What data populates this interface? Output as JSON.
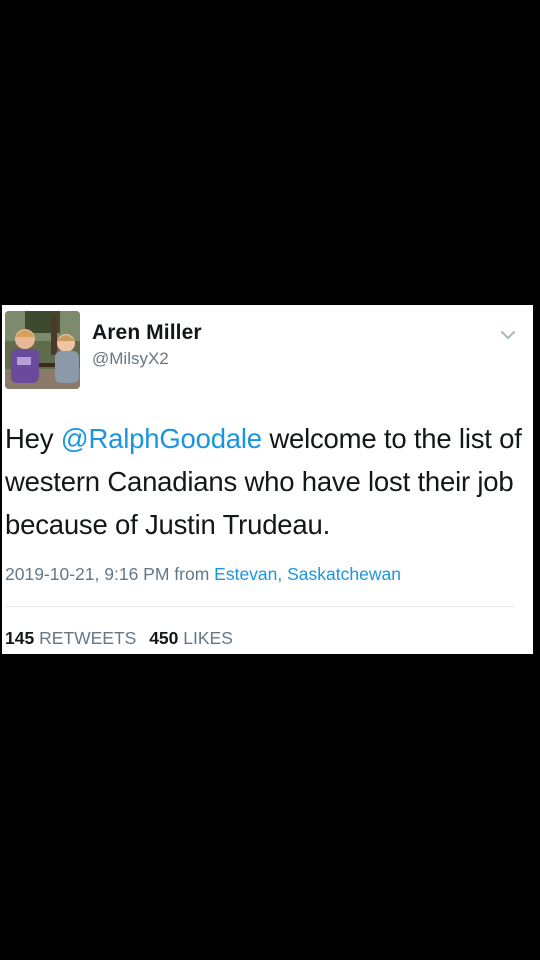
{
  "tweet": {
    "author_name": "Aren Miller",
    "author_handle": "@MilsyX2",
    "text_before": "Hey ",
    "mention": "@RalphGoodale",
    "text_after": " welcome to the list of western Canadians who have lost their job because of Justin Trudeau.",
    "timestamp": "2019-10-21, 9:16 PM from",
    "location": "Estevan, Saskatchewan",
    "retweets_count": "145",
    "retweets_label": "RETWEETS",
    "likes_count": "450",
    "likes_label": "LIKES"
  },
  "icons": {
    "avatar": "profile-photo",
    "menu": "chevron-down-icon"
  },
  "colors": {
    "background": "#000000",
    "card": "#ffffff",
    "link": "#1b95e0",
    "text": "#14171a",
    "secondary": "#657786"
  }
}
